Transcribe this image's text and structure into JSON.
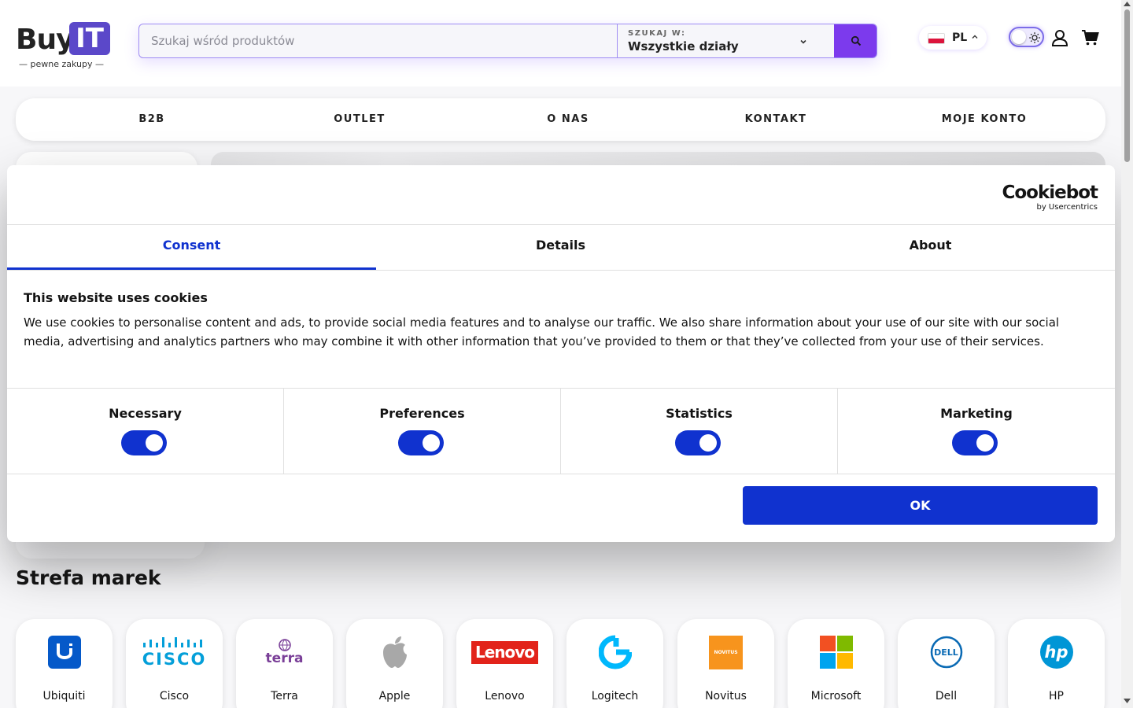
{
  "header": {
    "logo_main": "Buy",
    "logo_badge": "IT",
    "logo_tagline": "— pewne zakupy —",
    "search_placeholder": "Szukaj wśród produktów",
    "scope_label": "SZUKAJ W:",
    "scope_value": "Wszystkie działy",
    "language_code": "PL",
    "accent_color": "#7c3aed"
  },
  "nav": {
    "items": [
      {
        "label": "B2B"
      },
      {
        "label": "OUTLET"
      },
      {
        "label": "O NAS"
      },
      {
        "label": "KONTAKT"
      },
      {
        "label": "MOJE KONTO"
      }
    ]
  },
  "cookie": {
    "brand_name": "Cookiebot",
    "brand_by": "by Usercentrics",
    "tabs": [
      {
        "label": "Consent",
        "active": true
      },
      {
        "label": "Details",
        "active": false
      },
      {
        "label": "About",
        "active": false
      }
    ],
    "title": "This website uses cookies",
    "body": "We use cookies to personalise content and ads, to provide social media features and to analyse our traffic. We also share information about your use of our site with our social media, advertising and analytics partners who may combine it with other information that you’ve provided to them or that they’ve collected from your use of their services.",
    "categories": [
      {
        "label": "Necessary",
        "enabled": true
      },
      {
        "label": "Preferences",
        "enabled": true
      },
      {
        "label": "Statistics",
        "enabled": true
      },
      {
        "label": "Marketing",
        "enabled": true
      }
    ],
    "ok_label": "OK",
    "accent_color": "#1032cf"
  },
  "brands": {
    "title": "Strefa marek",
    "items": [
      {
        "name": "Ubiquiti"
      },
      {
        "name": "Cisco",
        "logo_text": "CISCO"
      },
      {
        "name": "Terra",
        "logo_text": "terra"
      },
      {
        "name": "Apple"
      },
      {
        "name": "Lenovo",
        "logo_text": "Lenovo"
      },
      {
        "name": "Logitech"
      },
      {
        "name": "Novitus",
        "logo_text": "NOVITUS"
      },
      {
        "name": "Microsoft"
      },
      {
        "name": "Dell",
        "logo_text": "DELL"
      },
      {
        "name": "HP",
        "logo_text": "hp"
      }
    ]
  }
}
